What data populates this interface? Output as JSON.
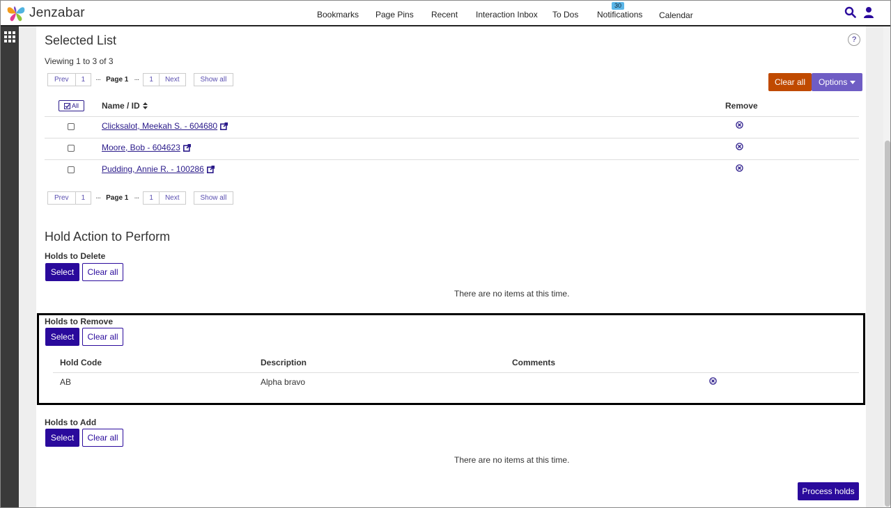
{
  "header": {
    "logo_text": "Jenzabar",
    "nav": [
      "Bookmarks",
      "Page Pins",
      "Recent",
      "Interaction Inbox",
      "To Dos",
      "Notifications",
      "Calendar"
    ],
    "notifications_count": "30"
  },
  "selected_list": {
    "title": "Selected List",
    "help": "?",
    "viewing": "Viewing 1 to 3 of 3",
    "pager": {
      "prev": "Prev",
      "first": "1",
      "dots": "···",
      "current": "Page 1",
      "last": "1",
      "next": "Next",
      "show_all": "Show all"
    },
    "clear_all": "Clear all",
    "options": "Options",
    "all_label": "All",
    "col_name": "Name / ID",
    "col_remove": "Remove",
    "rows": [
      {
        "name": "Clicksalot, Meekah S. - 604680"
      },
      {
        "name": "Moore, Bob - 604623"
      },
      {
        "name": "Pudding, Annie R. - 100286"
      }
    ]
  },
  "hold_action": {
    "title": "Hold Action to Perform",
    "select": "Select",
    "clear_all": "Clear all",
    "delete": {
      "label": "Holds to Delete",
      "empty": "There are no items at this time."
    },
    "remove": {
      "label": "Holds to Remove",
      "columns": [
        "Hold Code",
        "Description",
        "Comments"
      ],
      "rows": [
        {
          "code": "AB",
          "description": "Alpha bravo",
          "comments": ""
        }
      ]
    },
    "add": {
      "label": "Holds to Add",
      "empty": "There are no items at this time."
    },
    "process": "Process holds"
  },
  "colors": {
    "primary": "#2a0a9c",
    "orange": "#c04a00",
    "options": "#6f5dc4"
  }
}
